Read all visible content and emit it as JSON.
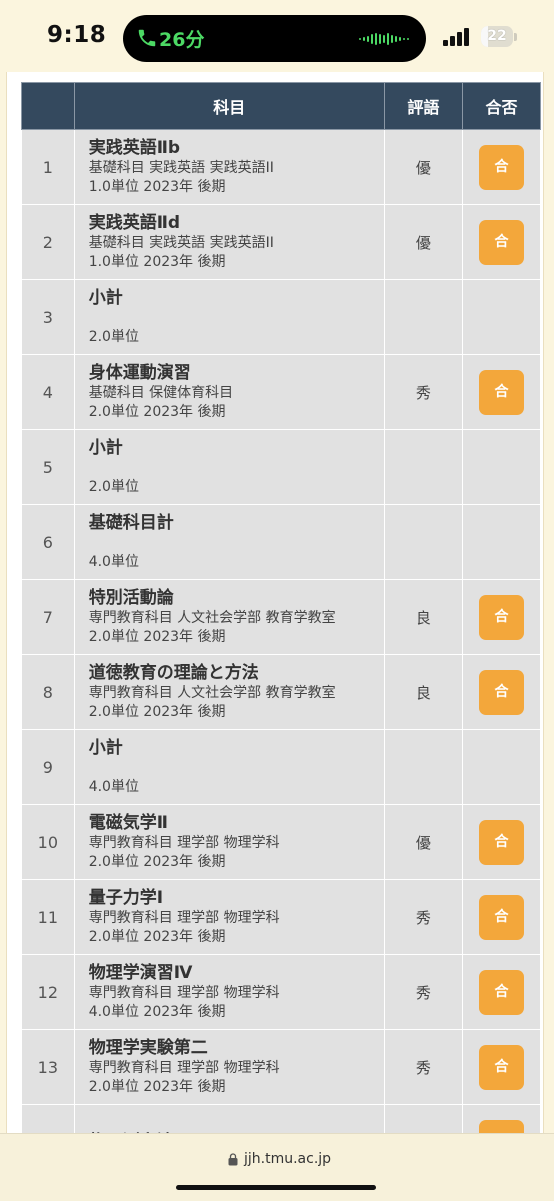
{
  "status_bar": {
    "time": "9:18",
    "call_duration": "26分",
    "battery": "22",
    "battery_level": 0.22
  },
  "table": {
    "headers": {
      "number": "",
      "subject": "科目",
      "evaluation": "評語",
      "pass": "合否"
    },
    "rows": [
      {
        "no": "1",
        "name": "実践英語Ⅱb",
        "detail": "基礎科目 実践英語 実践英語II",
        "units": "1.0単位 2023年 後期",
        "eval": "優",
        "pass": "合"
      },
      {
        "no": "2",
        "name": "実践英語Ⅱd",
        "detail": "基礎科目 実践英語 実践英語II",
        "units": "1.0単位 2023年 後期",
        "eval": "優",
        "pass": "合"
      },
      {
        "no": "3",
        "name": "小計",
        "detail": "",
        "units": "2.0単位",
        "eval": "",
        "pass": ""
      },
      {
        "no": "4",
        "name": "身体運動演習",
        "detail": "基礎科目 保健体育科目",
        "units": "2.0単位 2023年 後期",
        "eval": "秀",
        "pass": "合"
      },
      {
        "no": "5",
        "name": "小計",
        "detail": "",
        "units": "2.0単位",
        "eval": "",
        "pass": ""
      },
      {
        "no": "6",
        "name": "基礎科目計",
        "detail": "",
        "units": "4.0単位",
        "eval": "",
        "pass": ""
      },
      {
        "no": "7",
        "name": "特別活動論",
        "detail": "専門教育科目 人文社会学部 教育学教室",
        "units": "2.0単位 2023年 後期",
        "eval": "良",
        "pass": "合"
      },
      {
        "no": "8",
        "name": "道徳教育の理論と方法",
        "detail": "専門教育科目 人文社会学部 教育学教室",
        "units": "2.0単位 2023年 後期",
        "eval": "良",
        "pass": "合"
      },
      {
        "no": "9",
        "name": "小計",
        "detail": "",
        "units": "4.0単位",
        "eval": "",
        "pass": ""
      },
      {
        "no": "10",
        "name": "電磁気学Ⅱ",
        "detail": "専門教育科目 理学部 物理学科",
        "units": "2.0単位 2023年 後期",
        "eval": "優",
        "pass": "合"
      },
      {
        "no": "11",
        "name": "量子力学Ⅰ",
        "detail": "専門教育科目 理学部 物理学科",
        "units": "2.0単位 2023年 後期",
        "eval": "秀",
        "pass": "合"
      },
      {
        "no": "12",
        "name": "物理学演習Ⅳ",
        "detail": "専門教育科目 理学部 物理学科",
        "units": "4.0単位 2023年 後期",
        "eval": "秀",
        "pass": "合"
      },
      {
        "no": "13",
        "name": "物理学実験第二",
        "detail": "専門教育科目 理学部 物理学科",
        "units": "2.0単位 2023年 後期",
        "eval": "秀",
        "pass": "合"
      },
      {
        "no": "",
        "name": "物理測定法",
        "detail": "",
        "units": "",
        "eval": "",
        "pass": "合"
      }
    ]
  },
  "browser": {
    "url": "jjh.tmu.ac.jp"
  },
  "colors": {
    "header_bg": "#34495e",
    "pass_button": "#f3a73b",
    "row_bg": "#e1e1e1",
    "page_bg": "#fbf5de"
  }
}
